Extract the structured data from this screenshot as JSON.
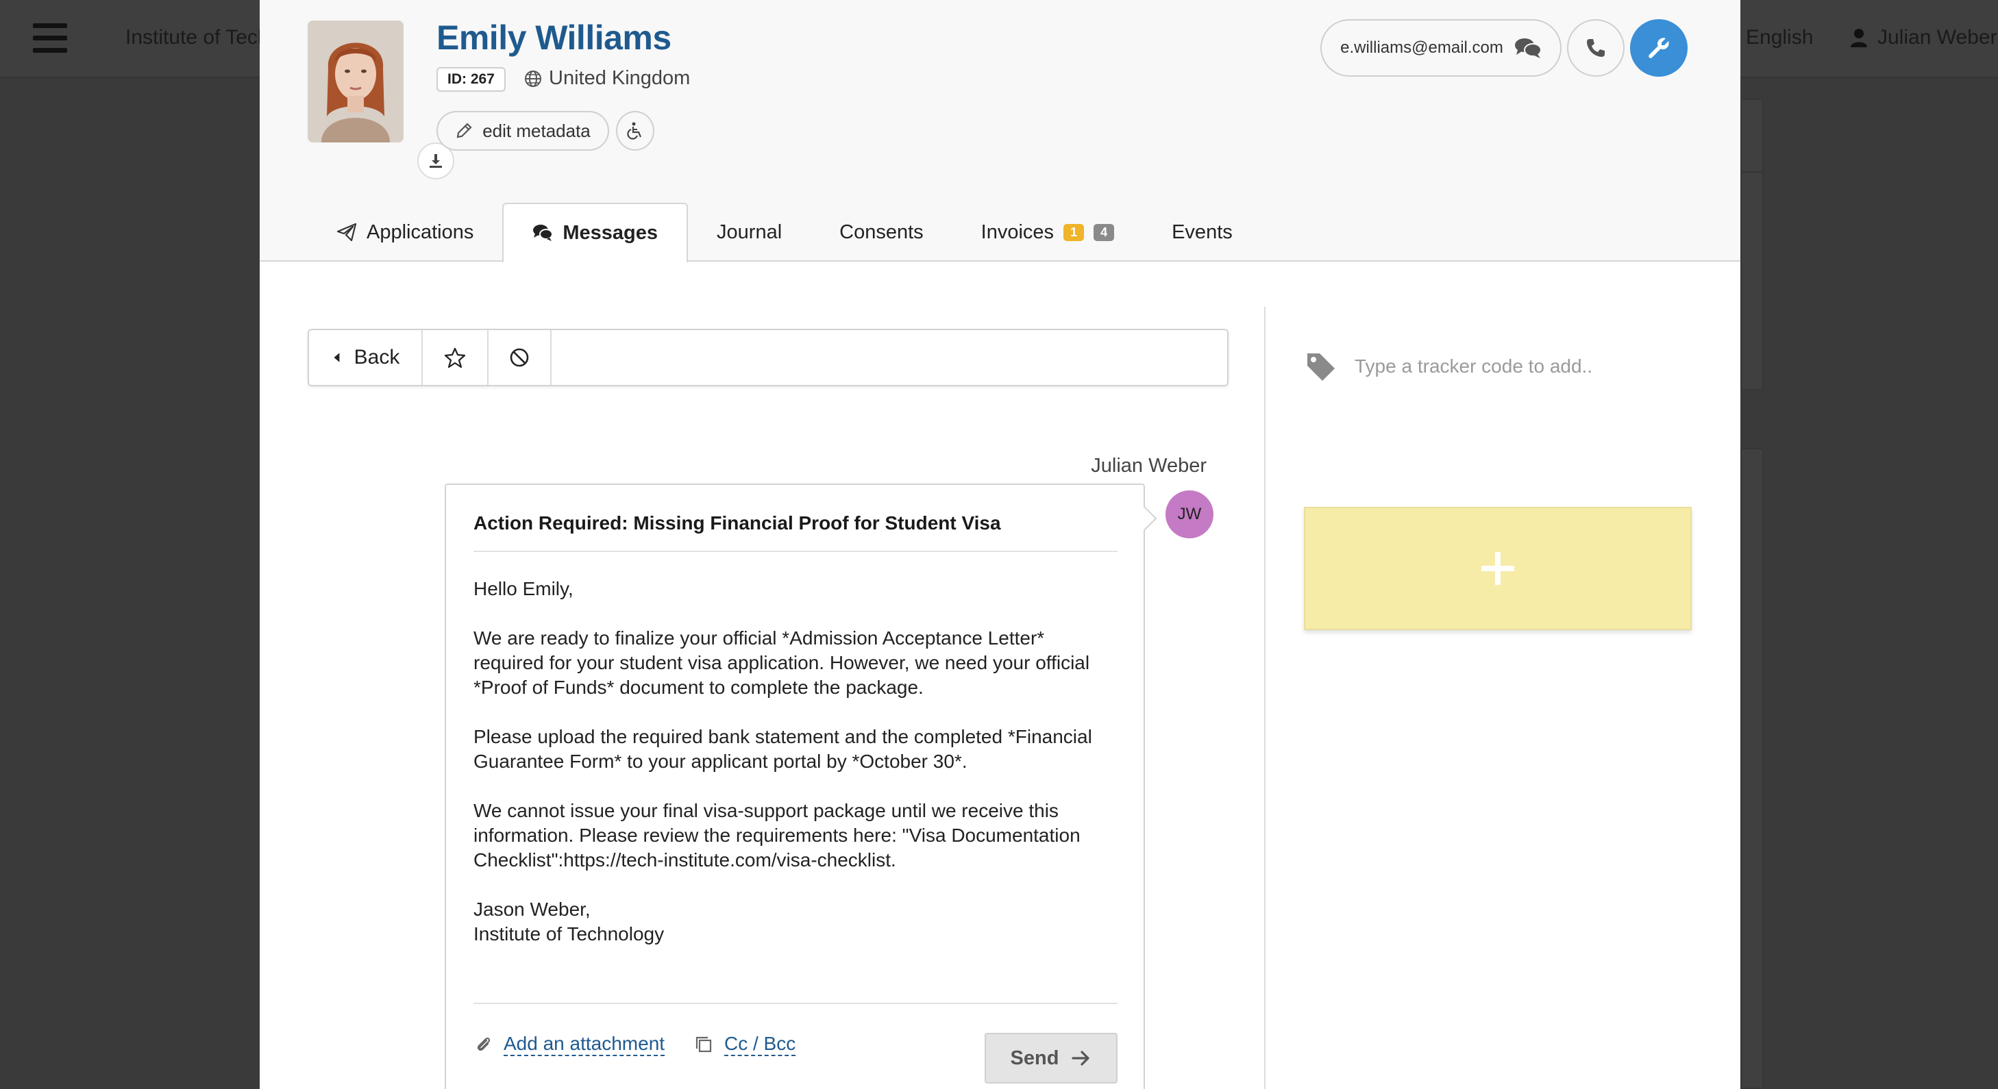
{
  "background": {
    "institution": "Institute of Tech",
    "language": "English",
    "user": "Julian Weber"
  },
  "profile": {
    "name": "Emily Williams",
    "id_label": "ID: 267",
    "country": "United Kingdom",
    "edit_metadata": "edit metadata",
    "email": "e.williams@email.com"
  },
  "tabs": [
    {
      "label": "Applications"
    },
    {
      "label": "Messages"
    },
    {
      "label": "Journal"
    },
    {
      "label": "Consents"
    },
    {
      "label": "Invoices",
      "badges": [
        "1",
        "4"
      ]
    },
    {
      "label": "Events"
    }
  ],
  "active_tab": "Messages",
  "toolbar": {
    "back_label": "Back"
  },
  "message": {
    "sender": "Julian Weber",
    "sender_initials": "JW",
    "subject": "Action Required: Missing Financial Proof for Student Visa",
    "paragraphs": [
      "Hello Emily,",
      "We are ready to finalize your official *Admission Acceptance Letter* required for your student visa application. However, we need your official *Proof of Funds* document to complete the package.",
      "Please upload the required bank statement and the completed *Financial Guarantee Form* to your applicant portal by *October 30*.",
      "We cannot issue your final visa-support package until we receive this information. Please review the requirements here: \"Visa Documentation Checklist\":https://tech-institute.com/visa-checklist."
    ],
    "signature_name": "Jason Weber,",
    "signature_org": "Institute of Technology",
    "attach_label": "Add an attachment",
    "cc_label": "Cc / Bcc",
    "send_label": "Send"
  },
  "tracker": {
    "placeholder": "Type a tracker code to add.."
  },
  "colors": {
    "name_blue": "#1f5a8f",
    "action_blue": "#3a8fd6",
    "badge_yellow": "#f0b429",
    "badge_gray": "#8a8a8a",
    "avatar_purple": "#c47ac4",
    "sticky_yellow": "#f7eba8"
  }
}
